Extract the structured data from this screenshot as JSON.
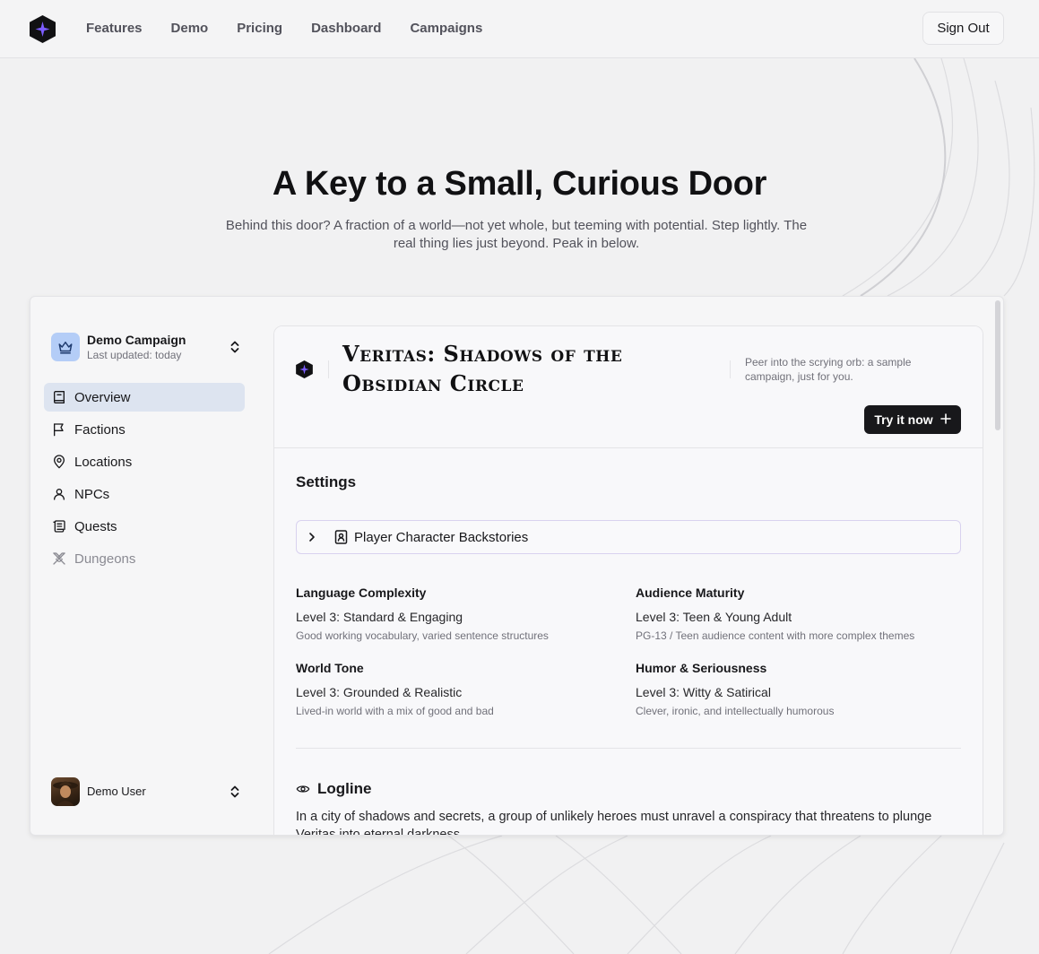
{
  "nav": {
    "links": [
      "Features",
      "Demo",
      "Pricing",
      "Dashboard",
      "Campaigns"
    ],
    "signout_label": "Sign Out"
  },
  "hero": {
    "title": "A Key to a Small, Curious Door",
    "subtitle": "Behind this door? A fraction of a world—not yet whole, but teeming with potential. Step lightly. The real thing lies just beyond. Peak in below."
  },
  "sidebar": {
    "campaign_name": "Demo Campaign",
    "campaign_updated": "Last updated: today",
    "items": [
      {
        "label": "Overview",
        "icon": "book-icon",
        "active": true
      },
      {
        "label": "Factions",
        "icon": "flag-icon"
      },
      {
        "label": "Locations",
        "icon": "map-pin-icon"
      },
      {
        "label": "NPCs",
        "icon": "user-icon"
      },
      {
        "label": "Quests",
        "icon": "scroll-icon"
      },
      {
        "label": "Dungeons",
        "icon": "swords-icon",
        "disabled": true
      }
    ],
    "user_name": "Demo User"
  },
  "card": {
    "title": "Veritas: Shadows of the Obsidian Circle",
    "description": "Peer into the scrying orb: a sample campaign, just for you.",
    "try_label": "Try it now",
    "settings_title": "Settings",
    "accordion_label": "Player Character Backstories",
    "settings": [
      {
        "heading": "Language Complexity",
        "value": "Level 3: Standard & Engaging",
        "desc": "Good working vocabulary, varied sentence structures"
      },
      {
        "heading": "Audience Maturity",
        "value": "Level 3: Teen & Young Adult",
        "desc": "PG-13 / Teen audience content with more complex themes"
      },
      {
        "heading": "World Tone",
        "value": "Level 3: Grounded & Realistic",
        "desc": "Lived-in world with a mix of good and bad"
      },
      {
        "heading": "Humor & Seriousness",
        "value": "Level 3: Witty & Satirical",
        "desc": "Clever, ironic, and intellectually humorous"
      }
    ],
    "logline_title": "Logline",
    "logline_text": "In a city of shadows and secrets, a group of unlikely heroes must unravel a conspiracy that threatens to plunge Veritas into eternal darkness."
  },
  "colors": {
    "accent_purple": "#7c5cff",
    "active_bg": "#dde4f0",
    "button_dark": "#18181b",
    "campaign_icon_bg": "#b4cdf7"
  }
}
